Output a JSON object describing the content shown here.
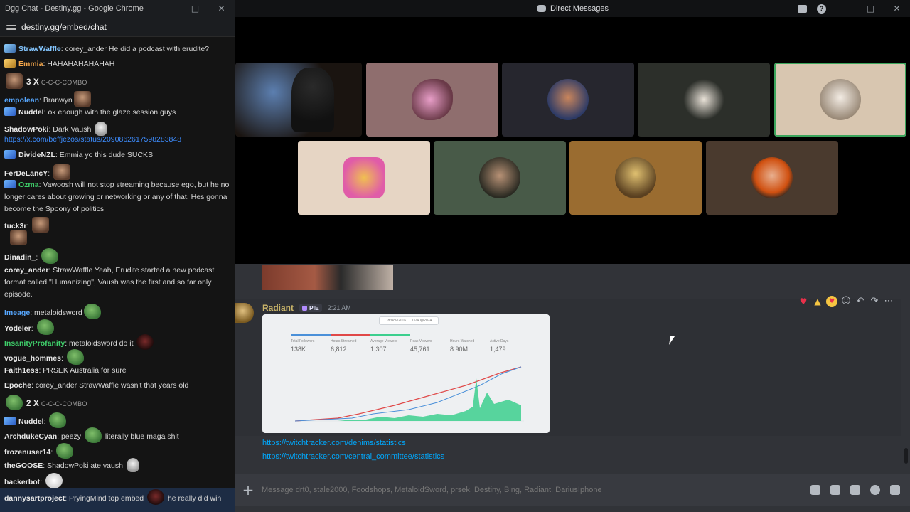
{
  "chat_window": {
    "title": "Dgg Chat - Destiny.gg - Google Chrome",
    "url": "destiny.gg/embed/chat",
    "messages": [
      {
        "user": "StrawWaffle",
        "text": "corey_ander He did a podcast with erudite?"
      },
      {
        "user": "Emmia",
        "text": "HAHAHAHAHAHAH"
      },
      {
        "combo_count": "3 X",
        "combo_label": "C-C-C-COMBO"
      },
      {
        "user": "empolean",
        "text": "Branwyn"
      },
      {
        "user": "Nuddel",
        "text": "ok enough with the glaze session guys"
      },
      {
        "user": "ShadowPoki",
        "text": "Dark Vaush"
      },
      {
        "link": "https://x.com/beffjezos/status/2090862617598283848"
      },
      {
        "user": "DivideNZL",
        "text": "Emmia yo this dude SUCKS"
      },
      {
        "user": "FerDeLancY",
        "text": ""
      },
      {
        "user": "Ozma",
        "text": "Vawoosh will not stop streaming because ego, but he no longer cares about growing or networking or any of that. Hes gonna become the Spoony of politics"
      },
      {
        "user": "tuck3r",
        "text": ""
      },
      {
        "user": "Dinadin_",
        "text": ""
      },
      {
        "user": "corey_ander",
        "text": "StrawWaffle Yeah, Erudite started a new podcast format called \"Humanizing\", Vaush was the first and so far only episode."
      },
      {
        "user": "Imeage",
        "text": "metaloidsword"
      },
      {
        "user": "Yodeler",
        "text": ""
      },
      {
        "user": "InsanityProfanity",
        "text": "metaloidsword do it"
      },
      {
        "user": "vogue_hommes",
        "text": ""
      },
      {
        "user": "Faith1ess",
        "text": "PRSEK Australia for sure"
      },
      {
        "user": "Epoche",
        "text": "corey_ander StrawWaffle wasn't that years old"
      },
      {
        "combo_count": "2 X",
        "combo_label": "C-C-C-COMBO"
      },
      {
        "user": "Nuddel",
        "text": ""
      },
      {
        "user": "ArchdukeCyan",
        "text": "peezy",
        "text_after": "literally blue maga shit"
      },
      {
        "user": "frozenuser14",
        "text": ""
      },
      {
        "user": "theGOOSE",
        "text": "ShadowPoki ate vaush"
      },
      {
        "user": "hackerbot",
        "text": ""
      },
      {
        "user": "dannysartproject",
        "text": "PryingMind top embed",
        "text_after": "he really did win"
      }
    ]
  },
  "discord": {
    "title": "Direct Messages",
    "message": {
      "author": "Radiant",
      "tag": "PIE",
      "time": "2:21 AM",
      "links": [
        "https://twitchtracker.com/denims/statistics",
        "https://twitchtracker.com/central_committee/statistics"
      ],
      "embed": {
        "date_range": "18/Nov/2016 → 15/Aug/2024",
        "stats": [
          {
            "label": "Total Followers",
            "value": "138K",
            "color": "#4a90d9"
          },
          {
            "label": "Hours Streamed",
            "value": "6,812",
            "color": "#e04848"
          },
          {
            "label": "Average Viewers",
            "value": "1,307",
            "color": "#3ccf8e"
          },
          {
            "label": "Peak Viewers",
            "value": "45,761",
            "color": ""
          },
          {
            "label": "Hours Watched",
            "value": "8.90M",
            "color": ""
          },
          {
            "label": "Active Days",
            "value": "1,479",
            "color": ""
          }
        ]
      }
    },
    "composer": {
      "placeholder": "Message drt0, stale2000, Foodshops, MetaloidSword, prsek, Destiny, Bing, Radiant, DariusIphone"
    },
    "colors": {
      "accent_green": "#3ba55c",
      "link": "#00a8fc",
      "author": "#c9b469"
    }
  }
}
